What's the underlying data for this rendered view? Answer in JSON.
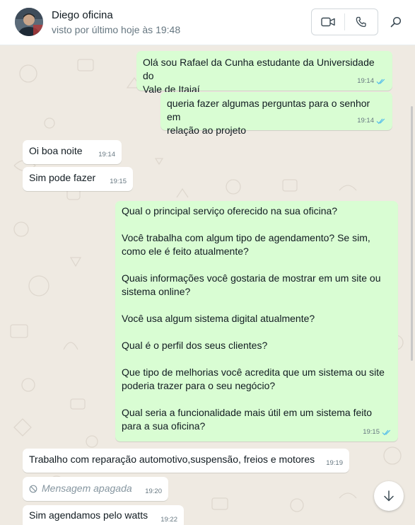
{
  "header": {
    "contact_name": "Diego oficina",
    "status": "visto por último hoje às 19:48"
  },
  "icons": {
    "video_call": "video-camera-icon",
    "voice_call": "phone-icon",
    "search": "search-icon",
    "scroll_down": "chevron-down-icon",
    "read": "double-check-icon",
    "deleted": "prohibited-icon"
  },
  "colors": {
    "outgoing_bubble": "#d9fdd3",
    "incoming_bubble": "#ffffff",
    "read_ticks": "#53bdeb",
    "chat_background": "#efeae2"
  },
  "messages": [
    {
      "direction": "out",
      "text": "Olá sou Rafael da Cunha estudante da Universidade do\nVale de Itajaí",
      "time": "19:14",
      "read": true
    },
    {
      "direction": "out",
      "text": "queria fazer algumas perguntas para o senhor em\nrelação ao projeto",
      "time": "19:14",
      "read": true
    },
    {
      "direction": "in",
      "text": "Oi boa noite",
      "time": "19:14"
    },
    {
      "direction": "in",
      "text": "Sim pode fazer",
      "time": "19:15"
    },
    {
      "direction": "out",
      "text": "Qual o principal serviço oferecido na sua oficina?\n\nVocê trabalha com algum tipo de agendamento? Se sim,\ncomo ele é feito atualmente?\n\nQuais informações você gostaria de mostrar em um site ou\nsistema online?\n\nVocê usa algum sistema digital atualmente?\n\nQual é o perfil dos seus clientes?\n\nQue tipo de melhorias você acredita que um sistema ou site\npoderia trazer para o seu negócio?\n\nQual seria a funcionalidade mais útil em um sistema feito\npara a sua oficina?",
      "time": "19:15",
      "read": true
    },
    {
      "direction": "in",
      "text": "Trabalho com reparação automotivo,suspensão, freios e motores",
      "time": "19:19"
    },
    {
      "direction": "in",
      "text": "Mensagem apagada",
      "time": "19:20",
      "deleted": true
    },
    {
      "direction": "in",
      "text": "Sim agendamos pelo watts",
      "time": "19:22"
    }
  ]
}
